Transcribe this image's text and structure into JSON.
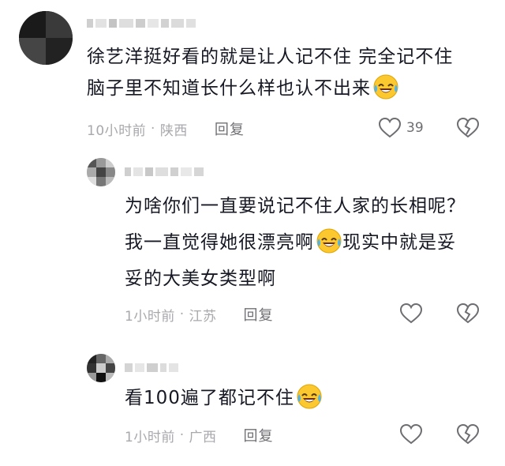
{
  "comments": [
    {
      "text": "徐艺洋挺好看的就是让人记不住 完全记不住脑子里不知道长什么样也认不出来",
      "time": "10小时前",
      "location": "陕西",
      "reply_label": "回复",
      "like_count": "39"
    },
    {
      "text": "为啥你们一直要说记不住人家的长相呢？我一直觉得她很漂亮啊",
      "text_after_emoji": "现实中就是妥妥的大美女类型啊",
      "time": "1小时前",
      "location": "江苏",
      "reply_label": "回复"
    },
    {
      "text": "看100遍了都记不住",
      "time": "1小时前",
      "location": "广西",
      "reply_label": "回复"
    }
  ],
  "icons": {
    "like": "heart-outline-icon",
    "dislike": "broken-heart-icon",
    "emoji": "laughing-crying-emoji"
  },
  "colors": {
    "text": "#161823",
    "meta": "#a8a8ad",
    "reply": "#707075",
    "icon": "#6d6d72"
  }
}
